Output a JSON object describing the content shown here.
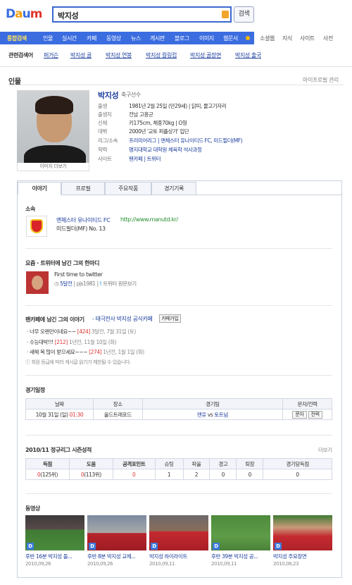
{
  "header": {
    "logo": "Daum",
    "query": "박지성",
    "search_button": "검색"
  },
  "gnb": {
    "tabs": [
      "통합검색",
      "인물",
      "실시간",
      "카페",
      "동영상",
      "뉴스",
      "게시판",
      "블로그",
      "이미지",
      "웹문서"
    ],
    "extra_tabs": [
      "소셜웹",
      "지식",
      "사이트",
      "사전"
    ]
  },
  "related": {
    "label": "관련검색어",
    "items": [
      "퍼거슨",
      "박지성 골",
      "박지성 연봉",
      "박지성 칼링컵",
      "박지성 골장면",
      "박지성 출국"
    ]
  },
  "person_section": {
    "title": "인물",
    "my_profile": "마이프로필 관리",
    "photo_more": "이미지 더보기",
    "name": "박지성",
    "job": "축구선수",
    "info": [
      {
        "key": "출생",
        "value": "1981년 2월 25일 (만29세) | 닭띠, 물고기자리"
      },
      {
        "key": "출생지",
        "value": "전남 고흥군"
      },
      {
        "key": "신체",
        "value": "키175cm, 체중70kg | O형"
      },
      {
        "key": "데뷔",
        "value": "2000년 '교토 퍼플상가' 입단"
      },
      {
        "key": "리그/소속",
        "value": "프리미어리그 | 맨체스터 유나이티드 FC, 미드필더(MF)"
      },
      {
        "key": "학력",
        "value": "명지대학교 대학원 체육학 석사과정"
      },
      {
        "key": "사이트",
        "value": "팬카페 | 트위터"
      }
    ]
  },
  "tabs": [
    "이야기",
    "프로필",
    "주요작품",
    "경기기록"
  ],
  "club": {
    "title": "소속",
    "name": "맨체스터 유나이티드 FC",
    "url": "http://www.manutd.kr/",
    "position": "미드필더(MF) No. 13"
  },
  "twitter": {
    "title": "요즘 · 트위터에 남긴 그의 한마디",
    "text": "First time to twitter",
    "meta_time": "5달전",
    "meta_id": "pjs1981",
    "meta_link": "트위터 원문보기"
  },
  "fancafe": {
    "title": "팬카페에 남긴 그의 이야기",
    "cafe": "- 태극전사 박지성 공식카페",
    "join": "카페가입",
    "posts": [
      {
        "text": "· 너무 오랜만이네요~~",
        "count": "[424]",
        "date": "3달전, 7월 31일 (토)"
      },
      {
        "text": "· 수능대박!!!",
        "count": "[212]",
        "date": "1년전, 11월 10일 (화)"
      },
      {
        "text": "· 새해 복 많이 받으세요~~~",
        "count": "[274]",
        "date": "1년전, 1월 1일 (화)"
      }
    ],
    "note": "회원 등급에 따라 게시글 읽기가 제한될 수 있습니다."
  },
  "schedule": {
    "title": "경기일정",
    "headers": [
      "날짜",
      "장소",
      "경기팀",
      "문자/전력"
    ],
    "row": {
      "date": "10월 31일 (일)",
      "time": "01:30",
      "place": "올드트래포드",
      "home": "맨유",
      "vs": "vs",
      "away": "토트넘",
      "btn1": "문자",
      "btn2": "전력"
    }
  },
  "season_stats": {
    "title": "2010/11 정규리그 시즌성적",
    "more": "더보기",
    "headers": [
      "득점",
      "도움",
      "공격포인트",
      "슈팅",
      "파울",
      "경고",
      "퇴장",
      "경기당득점"
    ],
    "values": [
      {
        "v": "0",
        "rank": "(125위)"
      },
      {
        "v": "0",
        "rank": "(113위)"
      },
      {
        "v": "0",
        "rank": ""
      },
      {
        "v": "1",
        "rank": ""
      },
      {
        "v": "2",
        "rank": ""
      },
      {
        "v": "0",
        "rank": ""
      },
      {
        "v": "0",
        "rank": ""
      },
      {
        "v": "0",
        "rank": ""
      }
    ]
  },
  "videos": {
    "title": "동영상",
    "items": [
      {
        "title": "후반 16분 박지성 돌...",
        "date": "2010,09,26"
      },
      {
        "title": "후반 8분 박지성 교체...",
        "date": "2010,09,26"
      },
      {
        "title": "박지성 하이라이트",
        "date": "2010,09,11"
      },
      {
        "title": "후반 39분 박지성 공...",
        "date": "2010,09,11"
      },
      {
        "title": "박지성 주요장면",
        "date": "2010,08,23"
      }
    ]
  }
}
